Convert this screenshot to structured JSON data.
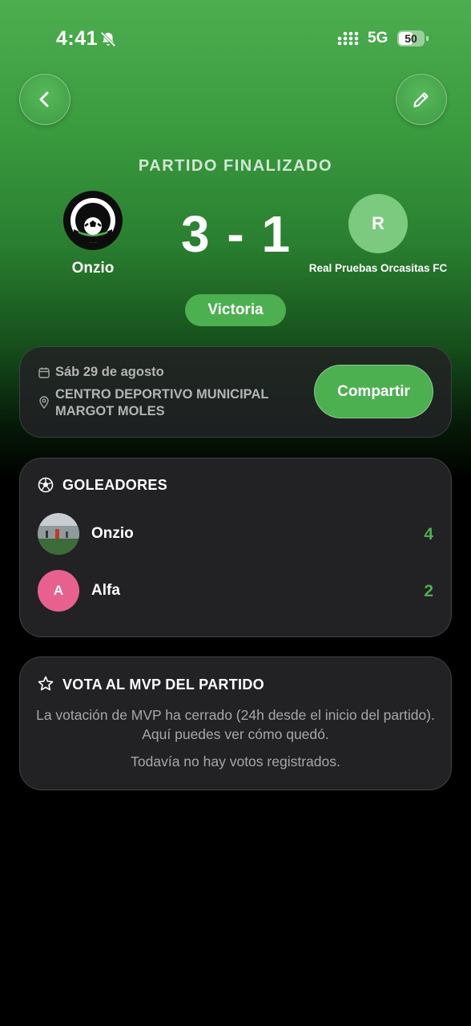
{
  "status_bar": {
    "time": "4:41",
    "network": "5G",
    "battery": "50"
  },
  "match": {
    "status": "PARTIDO FINALIZADO",
    "home": {
      "name": "Onzio"
    },
    "away": {
      "initial": "R",
      "name": "Real Pruebas Orcasitas FC"
    },
    "score": "3 - 1",
    "result": "Victoria"
  },
  "info": {
    "date": "Sáb 29 de agosto",
    "venue": "CENTRO DEPORTIVO MUNICIPAL MARGOT MOLES",
    "share_label": "Compartir"
  },
  "scorers": {
    "title": "GOLEADORES",
    "items": [
      {
        "name": "Onzio",
        "goals": "4"
      },
      {
        "name": "Alfa",
        "initial": "A",
        "goals": "2"
      }
    ]
  },
  "mvp": {
    "title": "VOTA AL MVP DEL PARTIDO",
    "description": "La votación de MVP ha cerrado (24h desde el inicio del partido). Aquí puedes ver cómo quedó.",
    "empty": "Todavía no hay votos registrados."
  },
  "colors": {
    "accent": "#4caf50",
    "card": "#222224",
    "muted": "#a7a7a7",
    "away_badge": "#7cc980",
    "avatar_pink": "#e8608e"
  },
  "icons": [
    "bell-slash-icon",
    "signal-icon",
    "battery-icon",
    "chevron-left-icon",
    "pencil-icon",
    "calendar-icon",
    "location-pin-icon",
    "soccer-ball-icon",
    "star-icon"
  ]
}
